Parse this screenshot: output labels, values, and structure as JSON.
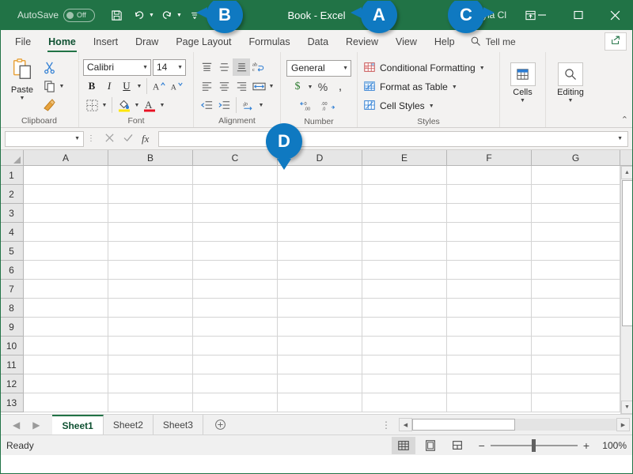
{
  "titlebar": {
    "autosave_label": "AutoSave",
    "autosave_state": "Off",
    "document_title": "Book  -  Excel",
    "user_name": "Kayla Cl",
    "qat": [
      {
        "name": "save",
        "label": "Save"
      },
      {
        "name": "undo",
        "label": "Undo"
      },
      {
        "name": "redo",
        "label": "Redo"
      },
      {
        "name": "customize-qat",
        "label": "Customize Quick Access Toolbar"
      }
    ],
    "window_controls": [
      "minimize",
      "maximize",
      "close"
    ],
    "ribbon_display_options": "Ribbon Display Options",
    "brand_color": "#217346"
  },
  "callouts": [
    {
      "id": "A",
      "label": "A"
    },
    {
      "id": "B",
      "label": "B"
    },
    {
      "id": "C",
      "label": "C"
    },
    {
      "id": "D",
      "label": "D"
    },
    {
      "color": "#0f79c1"
    }
  ],
  "callout_color": "#0f79c1",
  "tabs": {
    "items": [
      {
        "label": "File",
        "active": false
      },
      {
        "label": "Home",
        "active": true
      },
      {
        "label": "Insert",
        "active": false
      },
      {
        "label": "Draw",
        "active": false
      },
      {
        "label": "Page Layout",
        "active": false
      },
      {
        "label": "Formulas",
        "active": false
      },
      {
        "label": "Data",
        "active": false
      },
      {
        "label": "Review",
        "active": false
      },
      {
        "label": "View",
        "active": false
      },
      {
        "label": "Help",
        "active": false
      }
    ],
    "tellme_label": "Tell me",
    "share_label": "Share",
    "active_accent": "#217346"
  },
  "ribbon": {
    "clipboard": {
      "title": "Clipboard",
      "paste_label": "Paste",
      "cut_label": "Cut",
      "copy_label": "Copy",
      "format_painter_label": "Format Painter"
    },
    "font": {
      "title": "Font",
      "font_name": "Calibri",
      "font_size": "14",
      "bold_label": "B",
      "italic_label": "I",
      "underline_label": "U",
      "grow_font_label": "A",
      "shrink_font_label": "A",
      "borders_label": "Borders",
      "fill_color_label": "Fill Color",
      "font_color_label": "A"
    },
    "alignment": {
      "title": "Alignment",
      "top_align_label": "Top Align",
      "middle_align_label": "Middle Align",
      "bottom_align_label": "Bottom Align",
      "wrap_text_label": "Wrap Text",
      "align_left_label": "Align Left",
      "center_label": "Center",
      "align_right_label": "Align Right",
      "merge_center_label": "Merge & Center",
      "decrease_indent_label": "Decrease Indent",
      "increase_indent_label": "Increase Indent",
      "orientation_label": "Orientation"
    },
    "number": {
      "title": "Number",
      "format": "General",
      "accounting_label": "$",
      "percent_label": "%",
      "comma_label": ",",
      "increase_decimal_label": "Increase Decimal",
      "decrease_decimal_label": "Decrease Decimal"
    },
    "styles": {
      "title": "Styles",
      "items": [
        {
          "label": "Conditional Formatting"
        },
        {
          "label": "Format as Table"
        },
        {
          "label": "Cell Styles"
        }
      ]
    },
    "cells": {
      "title": "Cells",
      "label": "Cells"
    },
    "editing": {
      "title": "Editing",
      "label": "Editing"
    },
    "collapse_label": "Collapse the Ribbon"
  },
  "formula_bar": {
    "name_box_value": "",
    "name_box_placeholder": "",
    "cancel_label": "Cancel",
    "enter_label": "Enter",
    "insert_function_label": "fx",
    "formula_value": "",
    "expand_label": "Expand Formula Bar"
  },
  "grid": {
    "columns": [
      "A",
      "B",
      "C",
      "D",
      "E",
      "F",
      "G"
    ],
    "rows": [
      "1",
      "2",
      "3",
      "4",
      "5",
      "6",
      "7",
      "8",
      "9",
      "10",
      "11",
      "12",
      "13"
    ],
    "select_all_label": "Select All"
  },
  "sheets": {
    "prev_label": "Previous Sheet",
    "next_label": "Next Sheet",
    "tabs": [
      {
        "label": "Sheet1",
        "active": true
      },
      {
        "label": "Sheet2",
        "active": false
      },
      {
        "label": "Sheet3",
        "active": false
      }
    ],
    "add_label": "New sheet"
  },
  "status_bar": {
    "status_text": "Ready",
    "views": [
      {
        "name": "normal",
        "label": "Normal",
        "active": true
      },
      {
        "name": "page-layout",
        "label": "Page Layout",
        "active": false
      },
      {
        "name": "page-break-preview",
        "label": "Page Break Preview",
        "active": false
      }
    ],
    "zoom_out_label": "−",
    "zoom_in_label": "+",
    "zoom_level": "100%"
  }
}
